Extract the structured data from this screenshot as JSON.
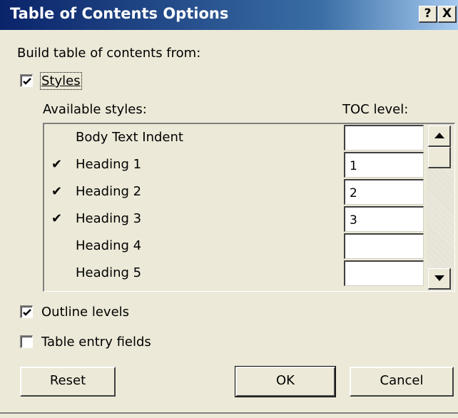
{
  "window": {
    "title": "Table of Contents Options",
    "help": "?",
    "close": "X"
  },
  "build_from_label": "Build table of contents from:",
  "styles_checkbox": {
    "label": "Styles",
    "checked": true
  },
  "available_styles_label": "Available styles:",
  "toc_level_label": "TOC level:",
  "styles": [
    {
      "mark": "",
      "name": "Body Text Indent",
      "level": ""
    },
    {
      "mark": "✔",
      "name": "Heading 1",
      "level": "1"
    },
    {
      "mark": "✔",
      "name": "Heading 2",
      "level": "2"
    },
    {
      "mark": "✔",
      "name": "Heading 3",
      "level": "3"
    },
    {
      "mark": "",
      "name": "Heading 4",
      "level": ""
    },
    {
      "mark": "",
      "name": "Heading 5",
      "level": ""
    }
  ],
  "outline_levels": {
    "label": "Outline levels",
    "checked": true
  },
  "table_entry_fields": {
    "label": "Table entry fields",
    "checked": false
  },
  "buttons": {
    "reset": "Reset",
    "ok": "OK",
    "cancel": "Cancel"
  },
  "icons": {
    "scroll_up": "up-arrow-icon",
    "scroll_down": "down-arrow-icon",
    "check": "check-icon"
  }
}
